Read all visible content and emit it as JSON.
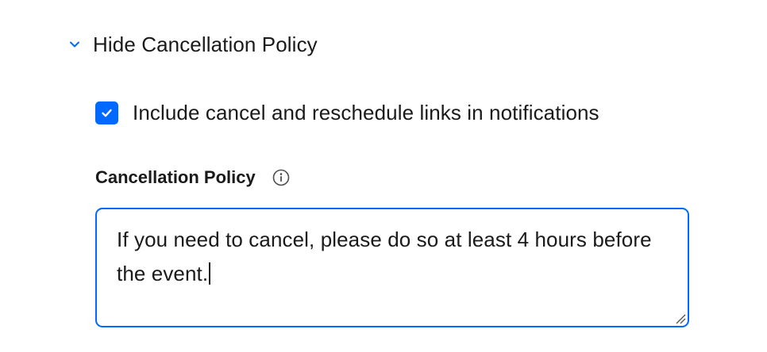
{
  "policy_toggle": {
    "label": "Hide Cancellation Policy",
    "expanded": true,
    "icon": "chevron-down-icon"
  },
  "notifications_checkbox": {
    "label": "Include cancel and reschedule links in notifications",
    "checked": true,
    "icon": "checkmark-icon"
  },
  "cancellation_policy": {
    "label": "Cancellation Policy",
    "info_icon": "info-icon",
    "value": "If you need to cancel, please do so at least 4 hours before the event."
  },
  "colors": {
    "accent": "#0069ff",
    "text": "#1a1a1a",
    "icon_gray": "#4d4d4d"
  }
}
